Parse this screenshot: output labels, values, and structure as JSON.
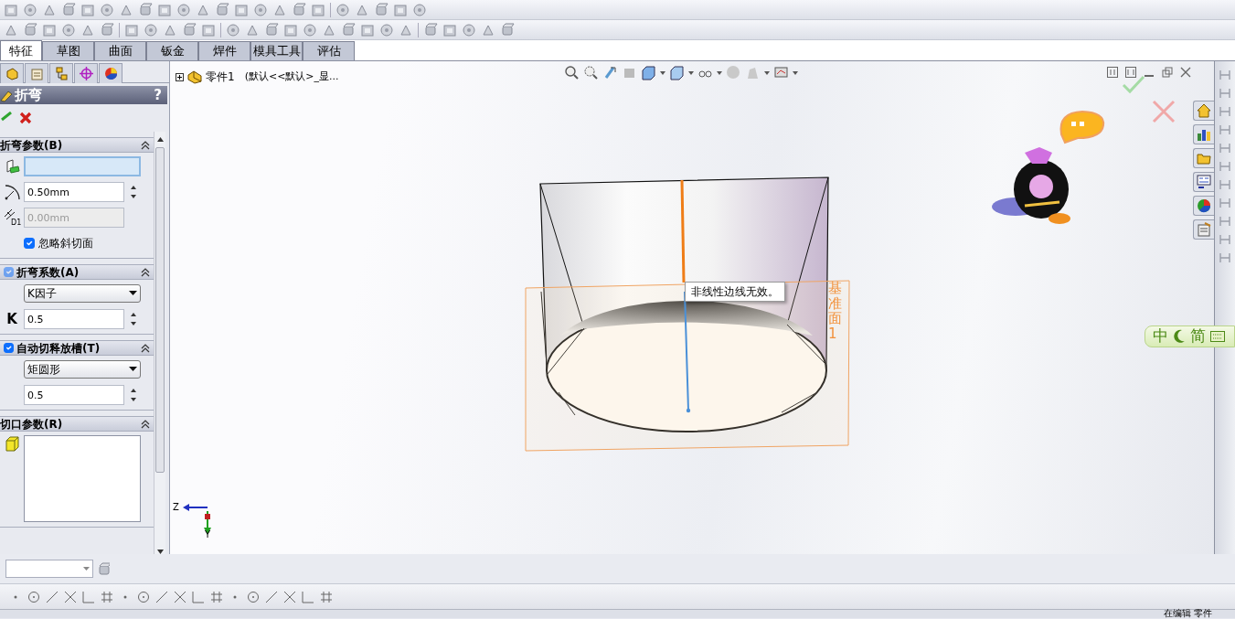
{
  "command_tabs": [
    {
      "label": "特征",
      "selected": true
    },
    {
      "label": "草图",
      "selected": false
    },
    {
      "label": "曲面",
      "selected": false
    },
    {
      "label": "钣金",
      "selected": false
    },
    {
      "label": "焊件",
      "selected": false
    },
    {
      "label": "模具工具",
      "selected": false
    },
    {
      "label": "评估",
      "selected": false
    }
  ],
  "feature_tree": {
    "root": "零件1",
    "config": "(默认<<默认>_显..."
  },
  "property_manager": {
    "title": "折弯",
    "help": "?",
    "sections": [
      {
        "title": "折弯参数(B)",
        "rows": [
          {
            "kind": "face_select",
            "value": "",
            "active": true
          },
          {
            "kind": "radius",
            "value": "0.50mm",
            "disabled": false
          },
          {
            "kind": "thickness",
            "icon_text": "D1",
            "value": "0.00mm",
            "disabled": true
          },
          {
            "kind": "checkbox",
            "label": "忽略斜切面",
            "checked": true
          }
        ]
      },
      {
        "title": "折弯系数(A)",
        "checkbox": {
          "checked": true,
          "disabled": true
        },
        "rows": [
          {
            "kind": "select",
            "value": "K因子"
          },
          {
            "kind": "k_spin",
            "label": "K",
            "value": "0.5",
            "disabled": false
          }
        ]
      },
      {
        "title": "自动切释放槽(T)",
        "checkbox": {
          "checked": true,
          "disabled": false
        },
        "rows": [
          {
            "kind": "select",
            "value": "矩圆形"
          },
          {
            "kind": "spin",
            "value": "0.5",
            "disabled": false
          }
        ]
      },
      {
        "title": "切口参数(R)",
        "rows": [
          {
            "kind": "listbox"
          }
        ]
      }
    ]
  },
  "viewport": {
    "tooltip": "非线性边线无效。",
    "plane_label": "基准面1",
    "triad": {
      "x_axis": "Z",
      "y_axis": "Y"
    }
  },
  "ime_bar": {
    "mode": "中",
    "charset": "简"
  },
  "status_bar": {
    "text": "在编辑 零件"
  }
}
